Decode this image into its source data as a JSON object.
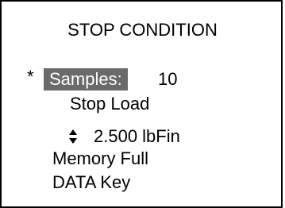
{
  "screen": {
    "title": "STOP CONDITION"
  },
  "menu": {
    "cursor_symbol": "*",
    "selected_label": "Samples:",
    "samples_value": "10",
    "stop_load_label": "Stop Load",
    "stop_load_value": "2.500 lbFin",
    "memory_full_label": "Memory Full",
    "data_key_label": "DATA Key"
  },
  "colors": {
    "selection_bg": "#6a6a6a",
    "text": "#000000",
    "background": "#ffffff"
  },
  "icons": {
    "spinner": "up-down-arrows-icon"
  }
}
